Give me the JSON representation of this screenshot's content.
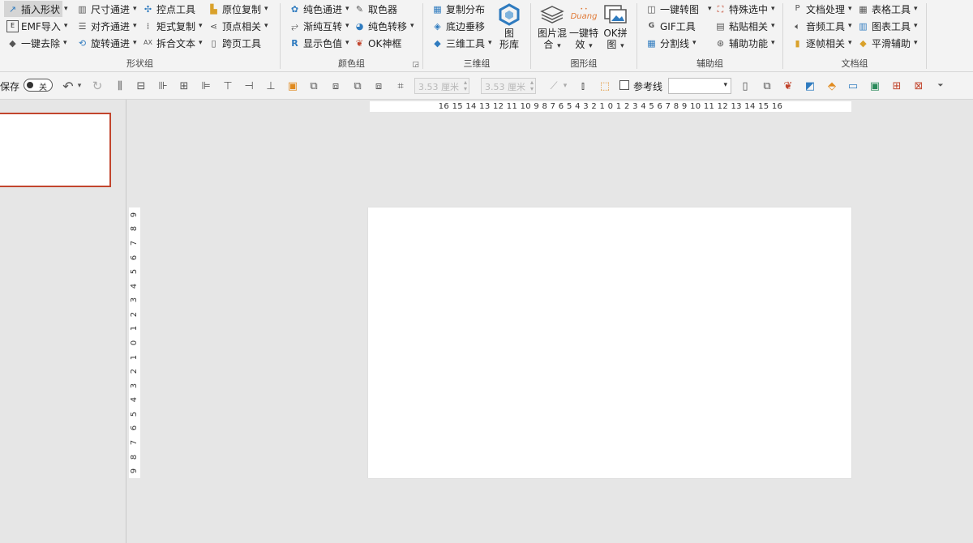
{
  "ribbon": {
    "shape_group": {
      "label": "形状组",
      "insert_shape": "插入形状",
      "emf_export": "EMF导入",
      "one_key_remove": "一键去除",
      "size_pass": "尺寸通进",
      "align_pass": "对齐通进",
      "rotate_pass": "旋转通进",
      "control_point": "控点工具",
      "matrix_copy": "矩式复制",
      "split_text": "拆合文本",
      "origin_copy": "原位复制",
      "vertex_related": "顶点相关",
      "cross_page": "跨页工具"
    },
    "color_group": {
      "label": "颜色组",
      "pure_pass": "纯色通进",
      "gradient_swap": "渐纯互转",
      "show_color": "显示色值",
      "picker": "取色器",
      "pure_convert": "纯色转移",
      "ok_frame": "OK神框"
    },
    "three_d_group": {
      "label": "三维组",
      "copy_distribute": "复制分布",
      "bottom_vertical": "底边垂移",
      "three_d_tool": "三维工具",
      "shape_lib_l1": "图",
      "shape_lib_l2": "形库"
    },
    "graphic_group": {
      "label": "图形组",
      "pic_mix_l1": "图片混",
      "pic_mix_l2": "合",
      "effect_l1": "一键特",
      "effect_l2": "效",
      "duang": "Duang",
      "ok_collage_l1": "OK拼",
      "ok_collage_l2": "图"
    },
    "aux_group": {
      "label": "辅助组",
      "to_image": "一键转图",
      "gif_tool": "GIF工具",
      "divider": "分割线",
      "special_select": "特殊选中",
      "paste_related": "粘贴相关",
      "aux_function": "辅助功能"
    },
    "doc_group": {
      "label": "文档组",
      "doc_process": "文档处理",
      "audio_tool": "音频工具",
      "frame_related": "逐帧相关",
      "table_tool": "表格工具",
      "chart_tool": "图表工具",
      "smooth_aux": "平滑辅助"
    }
  },
  "toolbar": {
    "autosave": "保存",
    "toggle_state": "关",
    "width_value": "3.53 厘米",
    "height_value": "3.53 厘米",
    "guide_label": "参考线"
  },
  "ruler": {
    "horizontal": "16 15 14 13 12 11 10 9 8 7 6 5 4 3 2 1 0 1 2 3 4 5 6 7 8 9 10 11 12 13 14 15 16",
    "vertical": [
      "9",
      "8",
      "7",
      "6",
      "5",
      "4",
      "3",
      "2",
      "1",
      "0",
      "1",
      "2",
      "3",
      "4",
      "5",
      "6",
      "7",
      "8",
      "9"
    ]
  },
  "colors": {
    "accent_red": "#c2452d",
    "ribbon_bg": "#f3f3f3",
    "workspace_bg": "#e6e6e6",
    "icon_blue": "#2f7bbf",
    "icon_orange": "#e07b39"
  },
  "icons": [
    "insert-shape-icon",
    "emf-icon",
    "eraser-icon",
    "size-icon",
    "align-icon",
    "rotate-icon",
    "control-point-icon",
    "matrix-icon",
    "split-text-icon",
    "origin-copy-icon",
    "vertex-icon",
    "cross-page-icon",
    "palette-icon",
    "gradient-icon",
    "color-value-icon",
    "eyedropper-icon",
    "color-move-icon",
    "ok-frame-icon",
    "copy-distribute-icon",
    "bottom-move-icon",
    "three-d-icon",
    "shape-library-icon",
    "picture-mix-icon",
    "duang-icon",
    "ok-collage-icon",
    "to-image-icon",
    "gif-icon",
    "divider-icon",
    "special-select-icon",
    "paste-icon",
    "aux-icon",
    "doc-process-icon",
    "audio-icon",
    "frame-icon",
    "table-icon",
    "chart-icon",
    "smooth-icon"
  ]
}
